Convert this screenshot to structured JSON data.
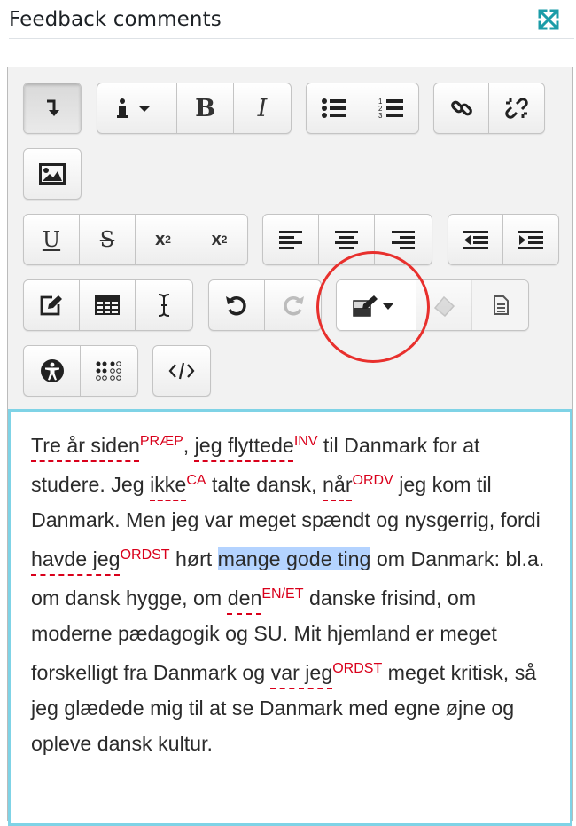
{
  "header": {
    "title": "Feedback comments",
    "expand_icon": "expand-arrows-icon",
    "accent": "#1b9ca8"
  },
  "toolbar": {
    "bold": "B",
    "italic": "I",
    "underline": "U",
    "strike": "S",
    "subscript": "x",
    "subscript_mark": "2",
    "superscript": "x",
    "superscript_mark": "2",
    "highlight_color": "#e8302d"
  },
  "content": {
    "border_color": "#7fd3e6",
    "segments": [
      {
        "t": "Tre år siden",
        "tag": "PRÆP"
      },
      {
        "t": ", "
      },
      {
        "t": "jeg flyttede",
        "tag": "INV"
      },
      {
        "t": " til Danmark for at studere. Jeg "
      },
      {
        "t": "ikke",
        "tag": "CA"
      },
      {
        "t": " talte dansk, "
      },
      {
        "t": "når",
        "tag": "ORDV"
      },
      {
        "t": " jeg kom til Danmark. Men jeg var meget spændt og nysgerrig, fordi "
      },
      {
        "t": "havde jeg",
        "tag": "ORDST"
      },
      {
        "t": " hørt "
      },
      {
        "t": "mange gode ting",
        "selected": true
      },
      {
        "t": " om Danmark: bl.a. om dansk hygge, om "
      },
      {
        "t": "den",
        "tag": "EN/ET"
      },
      {
        "t": " danske frisind, om moderne pædagogik og SU. Mit hjemland er meget forskelligt fra Danmark og "
      },
      {
        "t": "var jeg",
        "tag": "ORDST"
      },
      {
        "t": " meget kritisk, så jeg glædede mig til at se Danmark med egne øjne og opleve dansk kultur."
      }
    ]
  }
}
